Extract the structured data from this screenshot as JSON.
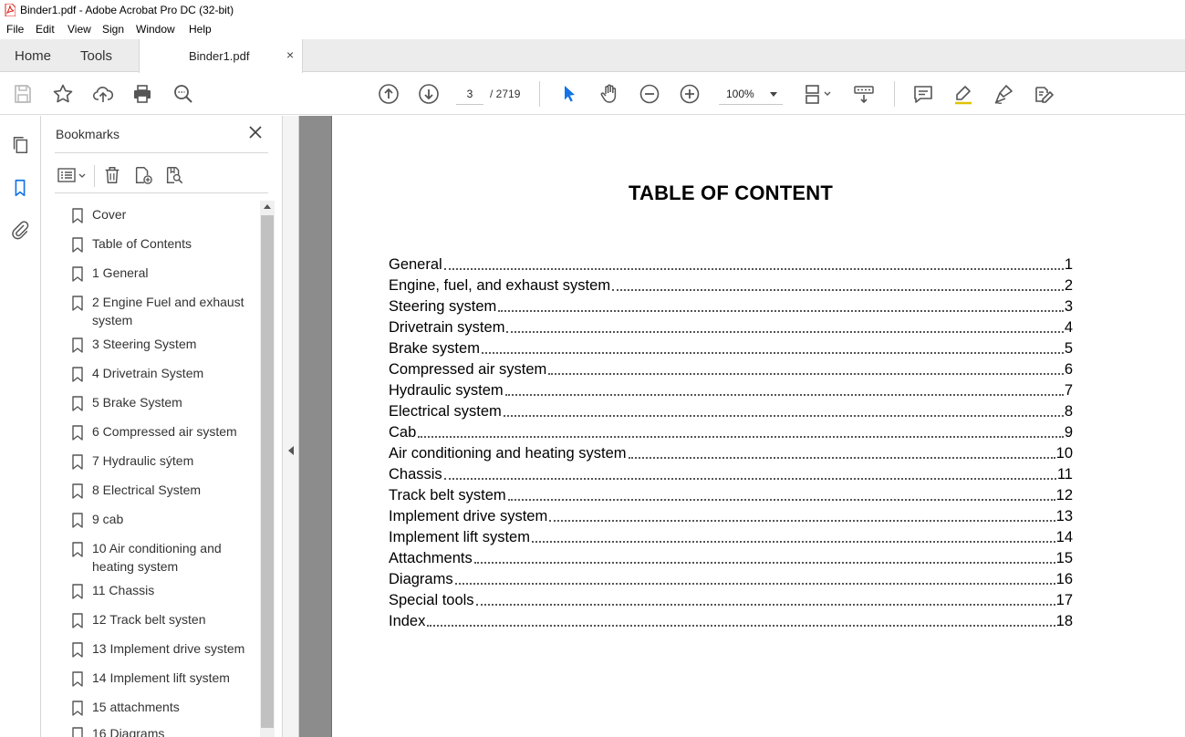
{
  "window": {
    "title": "Binder1.pdf - Adobe Acrobat Pro DC (32-bit)"
  },
  "menu": [
    "File",
    "Edit",
    "View",
    "Sign",
    "Window",
    "Help"
  ],
  "tabs": {
    "home": "Home",
    "tools": "Tools",
    "document": "Binder1.pdf",
    "close_glyph": "×"
  },
  "toolbar": {
    "current_page": "3",
    "page_total": "/ 2719",
    "zoom": "100%"
  },
  "bookmarks_panel": {
    "title": "Bookmarks",
    "items": [
      "Cover",
      "Table of Contents",
      "1 General",
      "2 Engine Fuel and exhaust system",
      "3 Steering System",
      "4 Drivetrain System",
      "5 Brake System",
      "6 Compressed air system",
      "7 Hydraulic sýtem",
      "8 Electrical System",
      "9 cab",
      "10 Air conditioning and heating system",
      "11 Chassis",
      "12 Track belt systen",
      "13 Implement drive system",
      "14 Implement lift system",
      "15 attachments",
      "16 Diagrams"
    ]
  },
  "document": {
    "heading": "TABLE OF CONTENT",
    "entries": [
      {
        "name": "General",
        "page": "1"
      },
      {
        "name": "Engine, fuel, and exhaust system",
        "page": "2"
      },
      {
        "name": "Steering system",
        "page": "3"
      },
      {
        "name": "Drivetrain system",
        "page": "4"
      },
      {
        "name": "Brake system",
        "page": "5"
      },
      {
        "name": "Compressed air system",
        "page": "6"
      },
      {
        "name": "Hydraulic system",
        "page": "7"
      },
      {
        "name": "Electrical system",
        "page": "8"
      },
      {
        "name": "Cab",
        "page": "9"
      },
      {
        "name": "Air conditioning and heating system",
        "page": "10"
      },
      {
        "name": "Chassis",
        "page": "11"
      },
      {
        "name": "Track belt system",
        "page": "12"
      },
      {
        "name": "Implement drive system",
        "page": "13"
      },
      {
        "name": "Implement lift system",
        "page": "14"
      },
      {
        "name": "Attachments",
        "page": "15"
      },
      {
        "name": "Diagrams",
        "page": "16"
      },
      {
        "name": "Special tools",
        "page": "17"
      },
      {
        "name": "Index",
        "page": "18"
      }
    ]
  },
  "colors": {
    "accent": "#1473e6",
    "viewport_bg": "#8c8c8c",
    "tab_bar": "#ececec"
  }
}
